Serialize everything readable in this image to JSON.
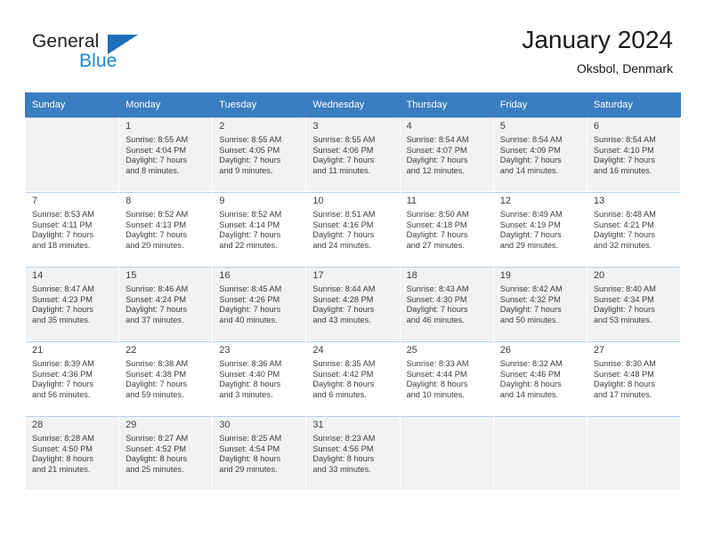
{
  "brand": {
    "name_part1": "General",
    "name_part2": "Blue",
    "triangle_color": "#1c6fba",
    "blue_color": "#1c87d6"
  },
  "header": {
    "title": "January 2024",
    "location": "Oksbol, Denmark"
  },
  "calendar": {
    "header_bg": "#3a7ebf",
    "weekday_headers": [
      "Sunday",
      "Monday",
      "Tuesday",
      "Wednesday",
      "Thursday",
      "Friday",
      "Saturday"
    ],
    "weeks": [
      [
        {
          "day": "",
          "sunrise": "",
          "sunset": "",
          "daylight1": "",
          "daylight2": ""
        },
        {
          "day": "1",
          "sunrise": "Sunrise: 8:55 AM",
          "sunset": "Sunset: 4:04 PM",
          "daylight1": "Daylight: 7 hours",
          "daylight2": "and 8 minutes."
        },
        {
          "day": "2",
          "sunrise": "Sunrise: 8:55 AM",
          "sunset": "Sunset: 4:05 PM",
          "daylight1": "Daylight: 7 hours",
          "daylight2": "and 9 minutes."
        },
        {
          "day": "3",
          "sunrise": "Sunrise: 8:55 AM",
          "sunset": "Sunset: 4:06 PM",
          "daylight1": "Daylight: 7 hours",
          "daylight2": "and 11 minutes."
        },
        {
          "day": "4",
          "sunrise": "Sunrise: 8:54 AM",
          "sunset": "Sunset: 4:07 PM",
          "daylight1": "Daylight: 7 hours",
          "daylight2": "and 12 minutes."
        },
        {
          "day": "5",
          "sunrise": "Sunrise: 8:54 AM",
          "sunset": "Sunset: 4:09 PM",
          "daylight1": "Daylight: 7 hours",
          "daylight2": "and 14 minutes."
        },
        {
          "day": "6",
          "sunrise": "Sunrise: 8:54 AM",
          "sunset": "Sunset: 4:10 PM",
          "daylight1": "Daylight: 7 hours",
          "daylight2": "and 16 minutes."
        }
      ],
      [
        {
          "day": "7",
          "sunrise": "Sunrise: 8:53 AM",
          "sunset": "Sunset: 4:11 PM",
          "daylight1": "Daylight: 7 hours",
          "daylight2": "and 18 minutes."
        },
        {
          "day": "8",
          "sunrise": "Sunrise: 8:52 AM",
          "sunset": "Sunset: 4:13 PM",
          "daylight1": "Daylight: 7 hours",
          "daylight2": "and 20 minutes."
        },
        {
          "day": "9",
          "sunrise": "Sunrise: 8:52 AM",
          "sunset": "Sunset: 4:14 PM",
          "daylight1": "Daylight: 7 hours",
          "daylight2": "and 22 minutes."
        },
        {
          "day": "10",
          "sunrise": "Sunrise: 8:51 AM",
          "sunset": "Sunset: 4:16 PM",
          "daylight1": "Daylight: 7 hours",
          "daylight2": "and 24 minutes."
        },
        {
          "day": "11",
          "sunrise": "Sunrise: 8:50 AM",
          "sunset": "Sunset: 4:18 PM",
          "daylight1": "Daylight: 7 hours",
          "daylight2": "and 27 minutes."
        },
        {
          "day": "12",
          "sunrise": "Sunrise: 8:49 AM",
          "sunset": "Sunset: 4:19 PM",
          "daylight1": "Daylight: 7 hours",
          "daylight2": "and 29 minutes."
        },
        {
          "day": "13",
          "sunrise": "Sunrise: 8:48 AM",
          "sunset": "Sunset: 4:21 PM",
          "daylight1": "Daylight: 7 hours",
          "daylight2": "and 32 minutes."
        }
      ],
      [
        {
          "day": "14",
          "sunrise": "Sunrise: 8:47 AM",
          "sunset": "Sunset: 4:23 PM",
          "daylight1": "Daylight: 7 hours",
          "daylight2": "and 35 minutes."
        },
        {
          "day": "15",
          "sunrise": "Sunrise: 8:46 AM",
          "sunset": "Sunset: 4:24 PM",
          "daylight1": "Daylight: 7 hours",
          "daylight2": "and 37 minutes."
        },
        {
          "day": "16",
          "sunrise": "Sunrise: 8:45 AM",
          "sunset": "Sunset: 4:26 PM",
          "daylight1": "Daylight: 7 hours",
          "daylight2": "and 40 minutes."
        },
        {
          "day": "17",
          "sunrise": "Sunrise: 8:44 AM",
          "sunset": "Sunset: 4:28 PM",
          "daylight1": "Daylight: 7 hours",
          "daylight2": "and 43 minutes."
        },
        {
          "day": "18",
          "sunrise": "Sunrise: 8:43 AM",
          "sunset": "Sunset: 4:30 PM",
          "daylight1": "Daylight: 7 hours",
          "daylight2": "and 46 minutes."
        },
        {
          "day": "19",
          "sunrise": "Sunrise: 8:42 AM",
          "sunset": "Sunset: 4:32 PM",
          "daylight1": "Daylight: 7 hours",
          "daylight2": "and 50 minutes."
        },
        {
          "day": "20",
          "sunrise": "Sunrise: 8:40 AM",
          "sunset": "Sunset: 4:34 PM",
          "daylight1": "Daylight: 7 hours",
          "daylight2": "and 53 minutes."
        }
      ],
      [
        {
          "day": "21",
          "sunrise": "Sunrise: 8:39 AM",
          "sunset": "Sunset: 4:36 PM",
          "daylight1": "Daylight: 7 hours",
          "daylight2": "and 56 minutes."
        },
        {
          "day": "22",
          "sunrise": "Sunrise: 8:38 AM",
          "sunset": "Sunset: 4:38 PM",
          "daylight1": "Daylight: 7 hours",
          "daylight2": "and 59 minutes."
        },
        {
          "day": "23",
          "sunrise": "Sunrise: 8:36 AM",
          "sunset": "Sunset: 4:40 PM",
          "daylight1": "Daylight: 8 hours",
          "daylight2": "and 3 minutes."
        },
        {
          "day": "24",
          "sunrise": "Sunrise: 8:35 AM",
          "sunset": "Sunset: 4:42 PM",
          "daylight1": "Daylight: 8 hours",
          "daylight2": "and 6 minutes."
        },
        {
          "day": "25",
          "sunrise": "Sunrise: 8:33 AM",
          "sunset": "Sunset: 4:44 PM",
          "daylight1": "Daylight: 8 hours",
          "daylight2": "and 10 minutes."
        },
        {
          "day": "26",
          "sunrise": "Sunrise: 8:32 AM",
          "sunset": "Sunset: 4:46 PM",
          "daylight1": "Daylight: 8 hours",
          "daylight2": "and 14 minutes."
        },
        {
          "day": "27",
          "sunrise": "Sunrise: 8:30 AM",
          "sunset": "Sunset: 4:48 PM",
          "daylight1": "Daylight: 8 hours",
          "daylight2": "and 17 minutes."
        }
      ],
      [
        {
          "day": "28",
          "sunrise": "Sunrise: 8:28 AM",
          "sunset": "Sunset: 4:50 PM",
          "daylight1": "Daylight: 8 hours",
          "daylight2": "and 21 minutes."
        },
        {
          "day": "29",
          "sunrise": "Sunrise: 8:27 AM",
          "sunset": "Sunset: 4:52 PM",
          "daylight1": "Daylight: 8 hours",
          "daylight2": "and 25 minutes."
        },
        {
          "day": "30",
          "sunrise": "Sunrise: 8:25 AM",
          "sunset": "Sunset: 4:54 PM",
          "daylight1": "Daylight: 8 hours",
          "daylight2": "and 29 minutes."
        },
        {
          "day": "31",
          "sunrise": "Sunrise: 8:23 AM",
          "sunset": "Sunset: 4:56 PM",
          "daylight1": "Daylight: 8 hours",
          "daylight2": "and 33 minutes."
        },
        {
          "day": "",
          "sunrise": "",
          "sunset": "",
          "daylight1": "",
          "daylight2": ""
        },
        {
          "day": "",
          "sunrise": "",
          "sunset": "",
          "daylight1": "",
          "daylight2": ""
        },
        {
          "day": "",
          "sunrise": "",
          "sunset": "",
          "daylight1": "",
          "daylight2": ""
        }
      ]
    ]
  }
}
